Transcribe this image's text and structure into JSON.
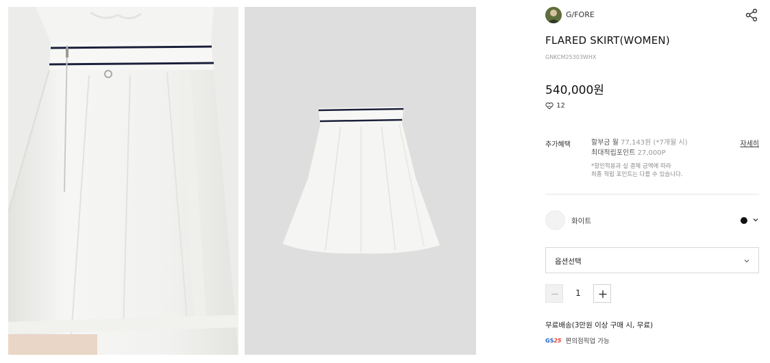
{
  "gallery": {
    "model_alt": "model wearing skirt",
    "product_alt": "skirt product shot",
    "tape_text": "G/FORE"
  },
  "brand": {
    "name": "G/FORE"
  },
  "product": {
    "title": "FLARED SKIRT(WOMEN)",
    "code": "GNKCM25303WHX",
    "price": "540,000원",
    "likes": "12"
  },
  "benefits": {
    "label": "추가혜택",
    "installment_label": "할부금 월",
    "installment_value": "77,143원 (*7개월 시)",
    "points_label": "최대적립포인트",
    "points_value": "27,000P",
    "note_line1": "*할인적용과 실 결제 금액에 따라",
    "note_line2": "최종 적립 포인트는 다를 수 있습니다.",
    "detail_link": "자세히"
  },
  "color": {
    "name": "화이트",
    "selected_hex": "#111111"
  },
  "option": {
    "placeholder": "옵션선택"
  },
  "quantity": {
    "value": "1"
  },
  "shipping": {
    "text": "무료배송(3만원 이상 구매 시, 무료)"
  },
  "pickup": {
    "logo_gs": "GS",
    "logo_25": "25",
    "text": "편의점픽업 가능"
  },
  "colors": {
    "accent": "#111111",
    "navy_stripe": "#1a1f3a",
    "gs_blue": "#1f62c7",
    "gs_red": "#e63c2f"
  }
}
